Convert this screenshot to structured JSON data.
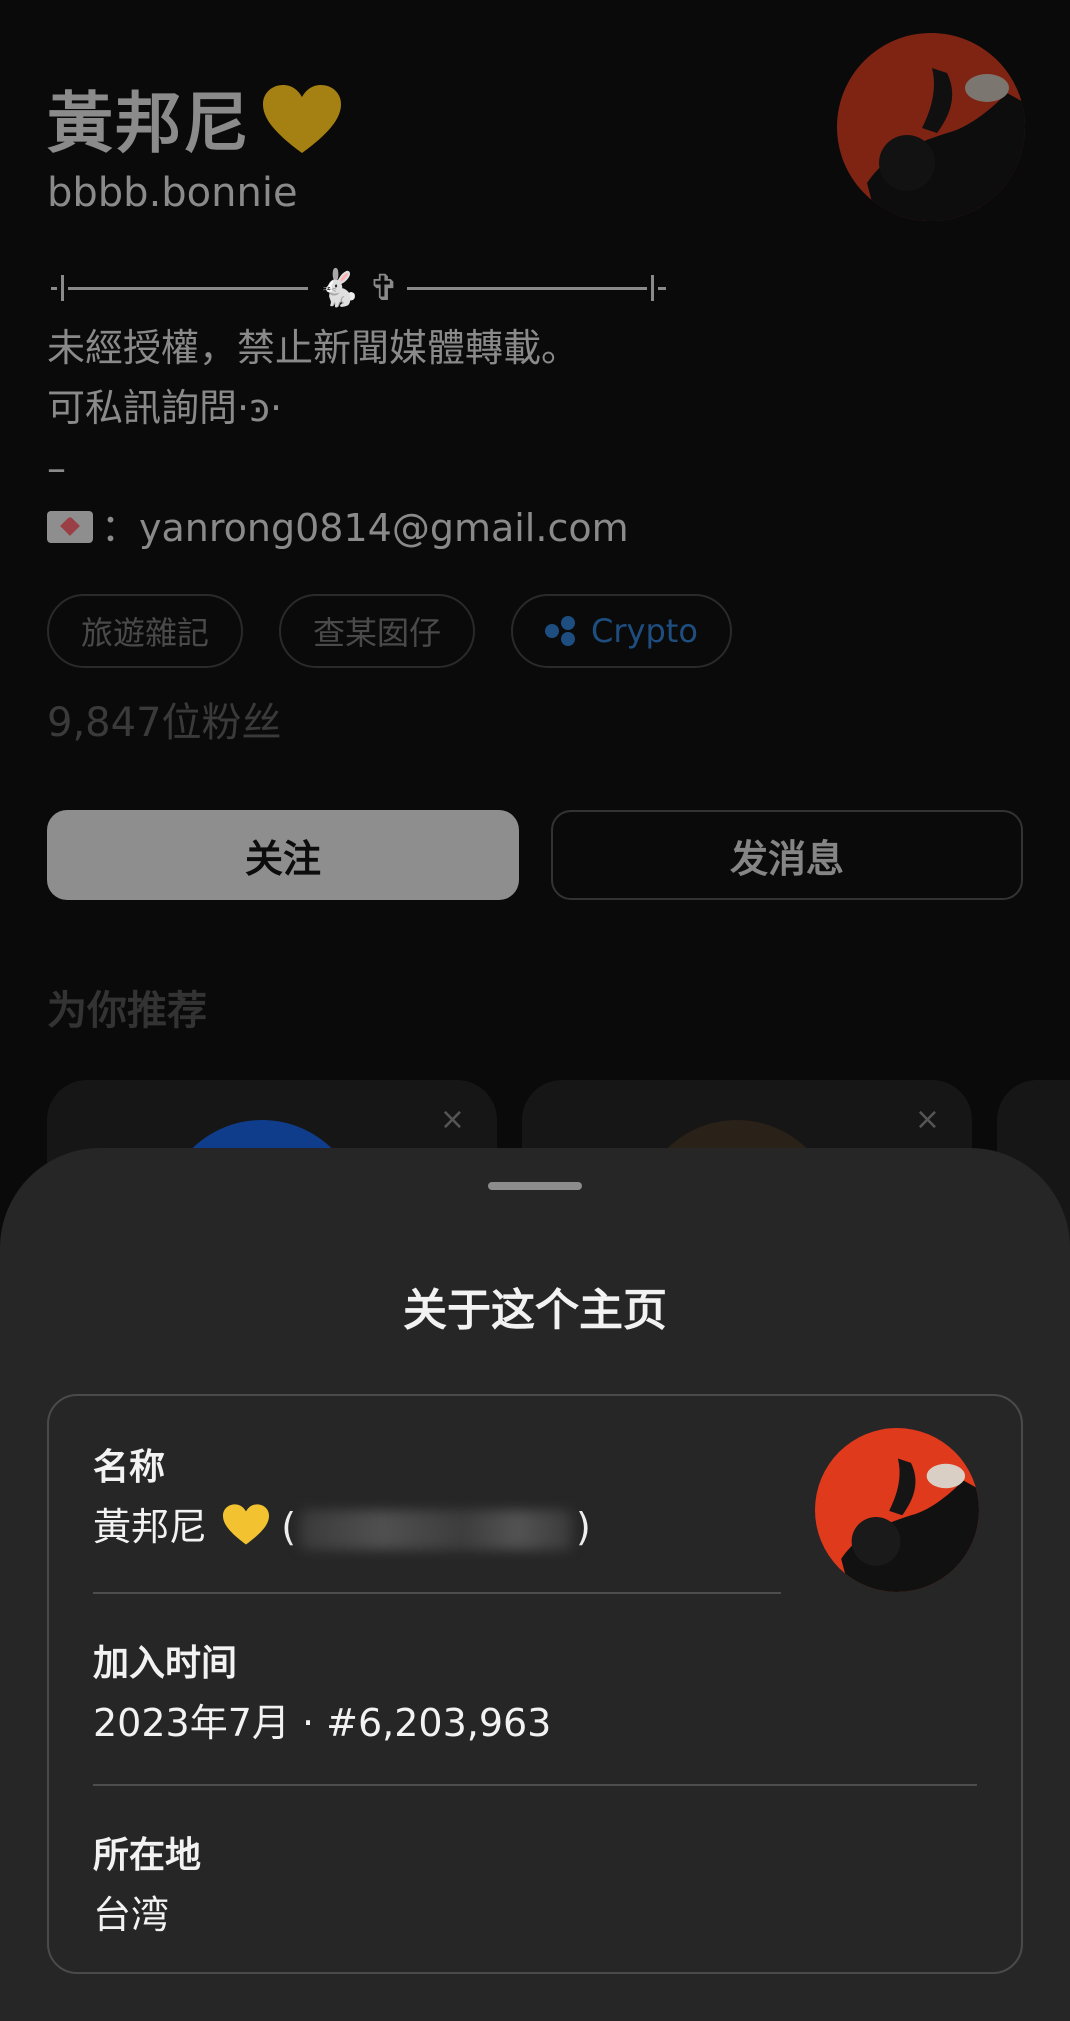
{
  "profile": {
    "name": "黃邦尼",
    "name_emoji": "yellow-heart",
    "handle": "bbbb.bonnie",
    "bio": {
      "line_cn_1": "未經授權，禁止新聞媒體轉載。",
      "line_cn_2": "可私訊詢問·ͽ·",
      "line_dash": "–",
      "email_sep": "：",
      "email": "yanrong0814@gmail.com"
    },
    "chips": [
      "旅遊雜記",
      "查某囡仔",
      "Crypto"
    ],
    "followers": "9,847位粉丝",
    "follow_label": "关注",
    "message_label": "发消息"
  },
  "recommend": {
    "title": "为你推荐",
    "close_glyph": "×"
  },
  "sheet": {
    "title": "关于这个主页",
    "name_label": "名称",
    "name_value": "黃邦尼",
    "name_paren_open": "(",
    "name_paren_close": ")",
    "joined_label": "加入时间",
    "joined_value": "2023年7月 · #6,203,963",
    "location_label": "所在地",
    "location_value": "台湾"
  },
  "colors": {
    "sheet_bg": "#262626",
    "accent_blue": "#1e4e80",
    "heart": "#f2c230",
    "avatar_bg": "#e03a1c"
  }
}
